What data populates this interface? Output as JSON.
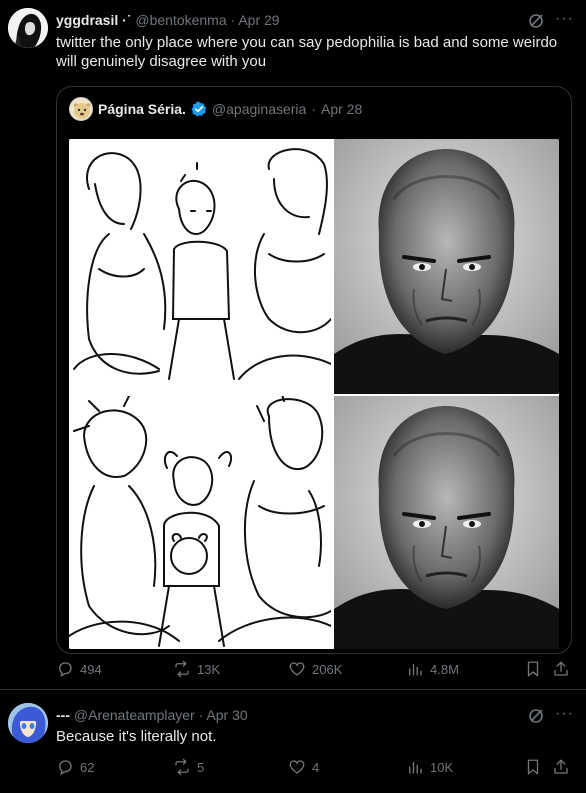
{
  "tweet1": {
    "display_name": "yggdrasil",
    "name_suffix": "·˙",
    "handle": "@bentokenma",
    "separator": "·",
    "date": "Apr 29",
    "text": "twitter the only place where you can say pedophilia is bad and some weirdo will genuinely disagree with you",
    "stats": {
      "replies": "494",
      "retweets": "13K",
      "likes": "206K",
      "views": "4.8M"
    },
    "quote": {
      "display_name": "Página Séria.",
      "handle": "@apaginaseria",
      "separator": "·",
      "date": "Apr 28"
    }
  },
  "tweet2": {
    "display_name": "---",
    "handle": "@Arenateamplayer",
    "separator": "·",
    "date": "Apr 30",
    "text": "Because it's literally not.",
    "stats": {
      "replies": "62",
      "retweets": "5",
      "likes": "4",
      "views": "10K"
    }
  },
  "colors": {
    "background": "#000000",
    "text": "#e7e9ea",
    "muted": "#71767b",
    "verified": "#1d9bf0",
    "border": "#2f3336"
  },
  "icons": [
    "grok-icon",
    "more-icon",
    "reply-icon",
    "retweet-icon",
    "like-icon",
    "views-icon",
    "bookmark-icon",
    "share-icon",
    "verified-badge-icon"
  ]
}
